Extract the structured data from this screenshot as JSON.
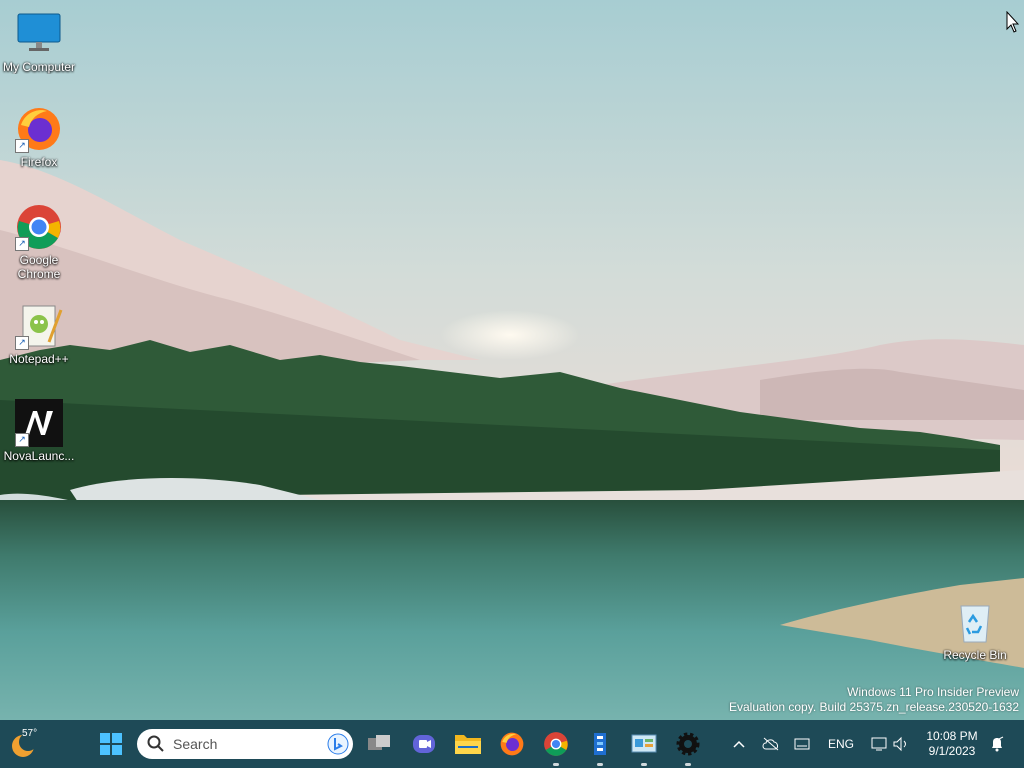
{
  "desktop": {
    "icons": [
      {
        "label": "My Computer",
        "icon": "monitor-icon"
      },
      {
        "label": "Firefox",
        "icon": "firefox-icon"
      },
      {
        "label": "Google Chrome",
        "icon": "chrome-icon"
      },
      {
        "label": "Notepad++",
        "icon": "notepadpp-icon"
      },
      {
        "label": "NovaLaunc...",
        "icon": "novalauncher-icon"
      },
      {
        "label": "Recycle Bin",
        "icon": "recycle-bin-icon"
      }
    ],
    "watermark": {
      "line1": "Windows 11 Pro Insider Preview",
      "line2": "Evaluation copy. Build 25375.zn_release.230520-1632"
    }
  },
  "taskbar": {
    "weather": {
      "temp": "57°"
    },
    "search": {
      "placeholder": "Search"
    },
    "tray": {
      "language": "ENG",
      "time": "10:08 PM",
      "date": "9/1/2023"
    }
  }
}
